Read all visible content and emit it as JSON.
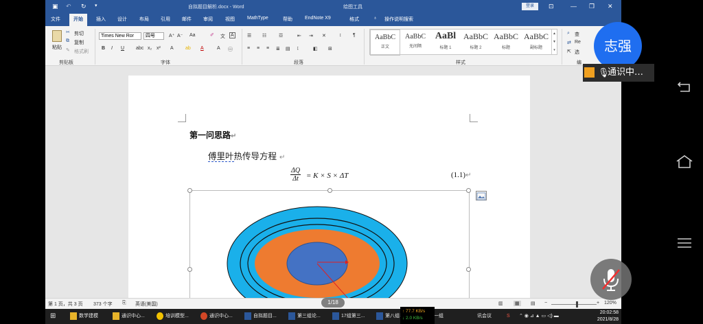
{
  "word": {
    "title": "自拟题目解析.docx  -  Word",
    "context_tab": "绘图工具",
    "login": "登录",
    "tabs": [
      "文件",
      "开始",
      "插入",
      "设计",
      "布局",
      "引用",
      "邮件",
      "审阅",
      "视图",
      "MathType",
      "帮助",
      "EndNote X9",
      "格式"
    ],
    "tell_me": "操作说明搜索",
    "clipboard": {
      "cut": "剪切",
      "copy": "复制",
      "format_painter": "格式刷",
      "paste": "粘贴",
      "label": "剪贴板"
    },
    "font": {
      "name": "Times New Ror",
      "size": "四号",
      "label": "字体"
    },
    "paragraph_label": "段落",
    "styles": {
      "label": "样式",
      "items": [
        {
          "preview": "AaBbC",
          "name": "正文"
        },
        {
          "preview": "AaBbC",
          "name": "无间隔"
        },
        {
          "preview": "AaBl",
          "name": "标题 1"
        },
        {
          "preview": "AaBbC",
          "name": "标题 2"
        },
        {
          "preview": "AaBbC",
          "name": "标题"
        },
        {
          "preview": "AaBbC",
          "name": "副标题"
        }
      ]
    },
    "editing": {
      "find": "查",
      "replace": "Re",
      "select": "选",
      "label": "编"
    }
  },
  "document": {
    "heading": "第一问思路",
    "subheading_link": "傅里叶",
    "subheading_rest": "热传导方程",
    "equation": {
      "num": "ΔQ",
      "den": "Δt",
      "rhs": "= K × S × ΔT",
      "number": "(1.1)"
    },
    "paragraph_mark": "↵"
  },
  "status": {
    "page": "第 1 页，共 3 页",
    "words": "373 个字",
    "lang": "英语(美国)",
    "zoom": "120%",
    "page_badge": "1/18"
  },
  "taskbar": {
    "items": [
      "数学建模",
      "通识中心...",
      "培训模型...",
      "通识中心...",
      "自拟题目...",
      "第三组论...",
      "17组第三...",
      "第八组初...",
      "第一组",
      "讯会议"
    ],
    "net_up": "↑ 77.7 KB/s",
    "net_down": "↓ 2.0 KB/s",
    "time": "20:02:58",
    "date": "2021/8/28"
  },
  "meeting": {
    "avatar_name": "志强",
    "talking_label": "通识中…"
  },
  "colors": {
    "word_blue": "#2b579a",
    "ring_cyan": "#1ab0ea",
    "ring_orange": "#ee7b30",
    "core_blue": "#4472c4",
    "arrow_red": "#e02020",
    "avatar_blue": "#1f6ef0"
  }
}
